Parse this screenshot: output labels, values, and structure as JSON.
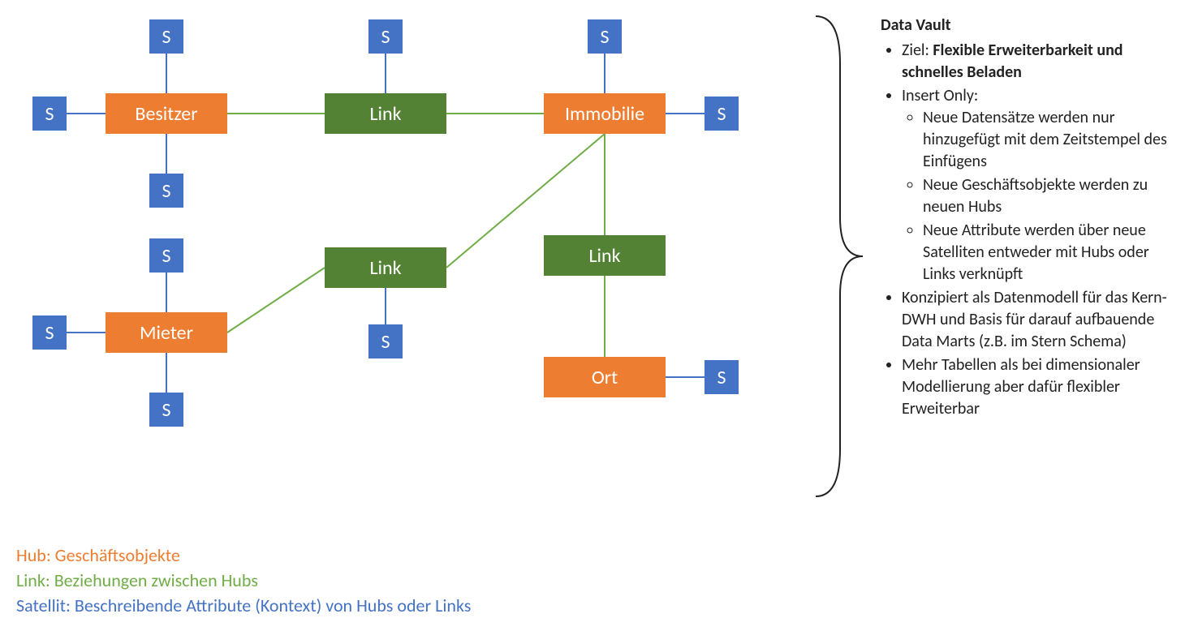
{
  "colors": {
    "hub": "#ED7D31",
    "link": "#548235",
    "link_line": "#70AD47",
    "satellite": "#4472C4",
    "sat_line": "#4472C4"
  },
  "nodes": {
    "hubs": {
      "besitzer": {
        "label": "Besitzer"
      },
      "immobilie": {
        "label": "Immobilie"
      },
      "mieter": {
        "label": "Mieter"
      },
      "ort": {
        "label": "Ort"
      }
    },
    "links": {
      "link_top": {
        "label": "Link"
      },
      "link_mid": {
        "label": "Link"
      },
      "link_right": {
        "label": "Link"
      }
    },
    "satellites": {
      "s": "S"
    }
  },
  "legend": {
    "hub": "Hub: Geschäftsobjekte",
    "link": "Link: Beziehungen zwischen Hubs",
    "sat": "Satellit: Beschreibende Attribute (Kontext) von Hubs oder Links"
  },
  "sidebar": {
    "title": "Data Vault",
    "b1_prefix": "Ziel: ",
    "b1_bold": "Flexible Erweiterbarkeit und schnelles Beladen",
    "b2": "Insert Only:",
    "b2a": "Neue Datensätze werden nur hinzugefügt mit dem Zeitstempel des Einfügens",
    "b2b": "Neue Geschäftsobjekte werden zu neuen Hubs",
    "b2c": "Neue Attribute werden über neue Satelliten entweder mit Hubs oder Links verknüpft",
    "b3": "Konzipiert als Datenmodell für das Kern-DWH und Basis für darauf aufbauende Data Marts (z.B. im Stern Schema)",
    "b4": "Mehr Tabellen als bei dimensionaler Modellierung aber dafür flexibler Erweiterbar"
  }
}
